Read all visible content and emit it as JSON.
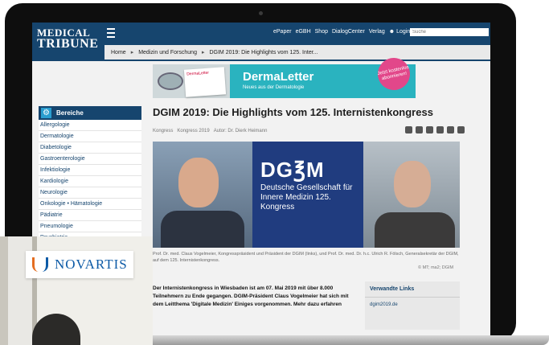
{
  "site": {
    "logo_line1": "MEDICAL",
    "logo_line2": "TRIBUNE",
    "nav": [
      "ePaper",
      "eGBH",
      "Shop",
      "DialogCenter",
      "Verlag"
    ],
    "login_label": "Login",
    "search_placeholder": "Suche"
  },
  "breadcrumb": [
    "Home",
    "Medizin und Forschung",
    "DGIM 2019: Die Highlights vom 125. Inter..."
  ],
  "banner": {
    "title": "DermaLetter",
    "subtitle": "Neues aus der Dermatologie",
    "cta": "Jetzt kostenlos abonnieren!",
    "paper_label": "DermaLetter"
  },
  "sidebar": {
    "title": "Bereiche",
    "items": [
      "Allergologie",
      "Dermatologie",
      "Diabetologie",
      "Gastroenterologie",
      "Infektiologie",
      "Kardiologie",
      "Neurologie",
      "Onkologie • Hämatologie",
      "Pädiatrie",
      "Pneumologie",
      "Psychiatrie"
    ]
  },
  "article": {
    "title": "DGIM 2019: Die Highlights vom 125. Internistenkongress",
    "meta": [
      "Kongress",
      "Kongress 2019",
      "Autor: Dr. Dierk Heimann"
    ],
    "image_text_big": "DG℥M",
    "image_text_small": "Deutsche Gesellschaft für Innere Medizin 125. Kongress",
    "caption": "Prof. Dr. med. Claus Vogelmeier, Kongresspräsident und Präsident der DGIM (links), und Prof. Dr. med. Dr. h.c. Ulrich R. Fölsch, Generalsekretär der DGIM, auf dem 125. Internistenkongress.",
    "credit": "© MT; ma2; DGIM",
    "body": "Der Internistenkongress in Wiesbaden ist am 07. Mai 2019 mit über 8.000 Teilnehmern zu Ende gegangen. DGIM-Präsident Claus Vogelmeier hat sich mit dem Leitthema 'Digitale Medizin' Einiges vorgenommen. Mehr dazu erfahren"
  },
  "related": {
    "title": "Verwandte Links",
    "item": "dgim2019.de"
  },
  "overlay": {
    "brand": "NOVARTIS"
  }
}
